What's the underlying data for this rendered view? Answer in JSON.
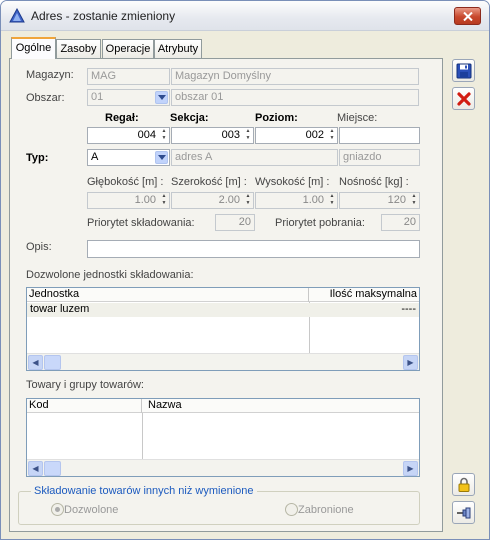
{
  "window": {
    "title": "Adres - zostanie zmieniony"
  },
  "tabs": [
    "Ogólne",
    "Zasoby",
    "Operacje",
    "Atrybuty"
  ],
  "form": {
    "magazyn_label": "Magazyn:",
    "magazyn_code": "MAG",
    "magazyn_name": "Magazyn Domyślny",
    "obszar_label": "Obszar:",
    "obszar_code": "01",
    "obszar_name": "obszar 01",
    "regal_label": "Regał:",
    "sekcja_label": "Sekcja:",
    "poziom_label": "Poziom:",
    "miejsce_label": "Miejsce:",
    "regal_value": "004",
    "sekcja_value": "003",
    "poziom_value": "002",
    "miejsce_value": "",
    "typ_label": "Typ:",
    "typ_code": "A",
    "typ_name": "adres A",
    "typ_extra": "gniazdo",
    "glebokosc_label": "Głębokość [m] :",
    "szerokosc_label": "Szerokość [m] :",
    "wysokosc_label": "Wysokość [m] :",
    "nosnosc_label": "Nośność [kg] :",
    "glebokosc_value": "1.00",
    "szerokosc_value": "2.00",
    "wysokosc_value": "1.00",
    "nosnosc_value": "120",
    "priorytet_skl_label": "Priorytet składowania:",
    "priorytet_skl_value": "20",
    "priorytet_pob_label": "Priorytet pobrania:",
    "priorytet_pob_value": "20",
    "opis_label": "Opis:",
    "opis_value": ""
  },
  "units_section": {
    "label": "Dozwolone jednostki składowania:",
    "columns": [
      "Jednostka",
      "Ilość maksymalna"
    ],
    "rows": [
      [
        "towar luzem",
        "----"
      ]
    ]
  },
  "goods_section": {
    "label": "Towary i grupy towarów:",
    "columns": [
      "Kod",
      "Nazwa"
    ],
    "rows": []
  },
  "other_goods": {
    "caption": "Składowanie towarów innych niż wymienione",
    "option_allowed": "Dozwolone",
    "option_forbidden": "Zabronione",
    "selected": "Dozwolone"
  },
  "colors": {
    "accent": "#f0a53a",
    "close": "#c8482d",
    "caption": "#1d5bbf"
  },
  "icons": [
    "app-triangle-icon",
    "close-icon",
    "save-icon",
    "delete-icon",
    "lock-icon",
    "pin-icon",
    "chevron-down-icon",
    "arrow-left-icon",
    "arrow-right-icon"
  ]
}
